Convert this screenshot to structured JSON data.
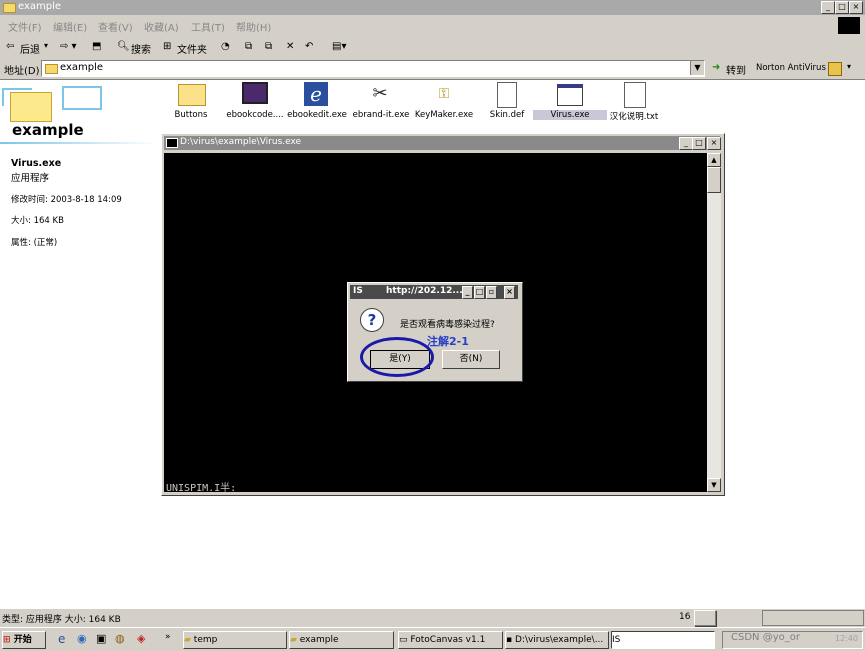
{
  "window": {
    "title": "example"
  },
  "menu": [
    "文件(F)",
    "编辑(E)",
    "查看(V)",
    "收藏(A)",
    "工具(T)",
    "帮助(H)"
  ],
  "toolbar": {
    "back": "后退",
    "search": "搜索",
    "folders": "文件夹"
  },
  "address": {
    "label": "地址(D)",
    "value": "example",
    "go": "转到",
    "norton": "Norton AntiVirus"
  },
  "left": {
    "folder_title": "example",
    "file_name": "Virus.exe",
    "file_type": "应用程序",
    "modified": "修改时间: 2003-8-18 14:09",
    "size": "大小: 164 KB",
    "attrs": "属性: (正常)"
  },
  "files": [
    {
      "name": "Buttons",
      "icon": "folder-icon"
    },
    {
      "name": "ebookcode....",
      "icon": "app-icon"
    },
    {
      "name": "ebookedit.exe",
      "icon": "ie-icon"
    },
    {
      "name": "ebrand-it.exe",
      "icon": "tools-icon"
    },
    {
      "name": "KeyMaker.exe",
      "icon": "key-icon"
    },
    {
      "name": "Skin.def",
      "icon": "document-icon"
    },
    {
      "name": "Virus.exe",
      "icon": "window-icon"
    },
    {
      "name": "汉化说明.txt",
      "icon": "text-icon"
    }
  ],
  "console": {
    "title": "D:\\virus\\example\\Virus.exe",
    "prompt": "UNISPIM.I半:"
  },
  "dialog": {
    "title": "http://202.12...",
    "prefix": "IS",
    "message": "是否观看病毒感染过程?",
    "annotation": "注解2-1",
    "yes": "是(Y)",
    "no": "否(N)"
  },
  "status": {
    "text": "类型: 应用程序 大小: 164 KB",
    "zone_label": "16"
  },
  "taskbar": {
    "start": "开始",
    "tasks": [
      "temp",
      "example",
      "FotoCanvas v1.1",
      "D:\\virus\\example\\...",
      "IS"
    ],
    "watermark": "CSDN @yo_or",
    "clock": "12:40"
  },
  "colors": {
    "annotation_circle": "#1a1aa8",
    "annotation_text": "#2a3fc8"
  }
}
